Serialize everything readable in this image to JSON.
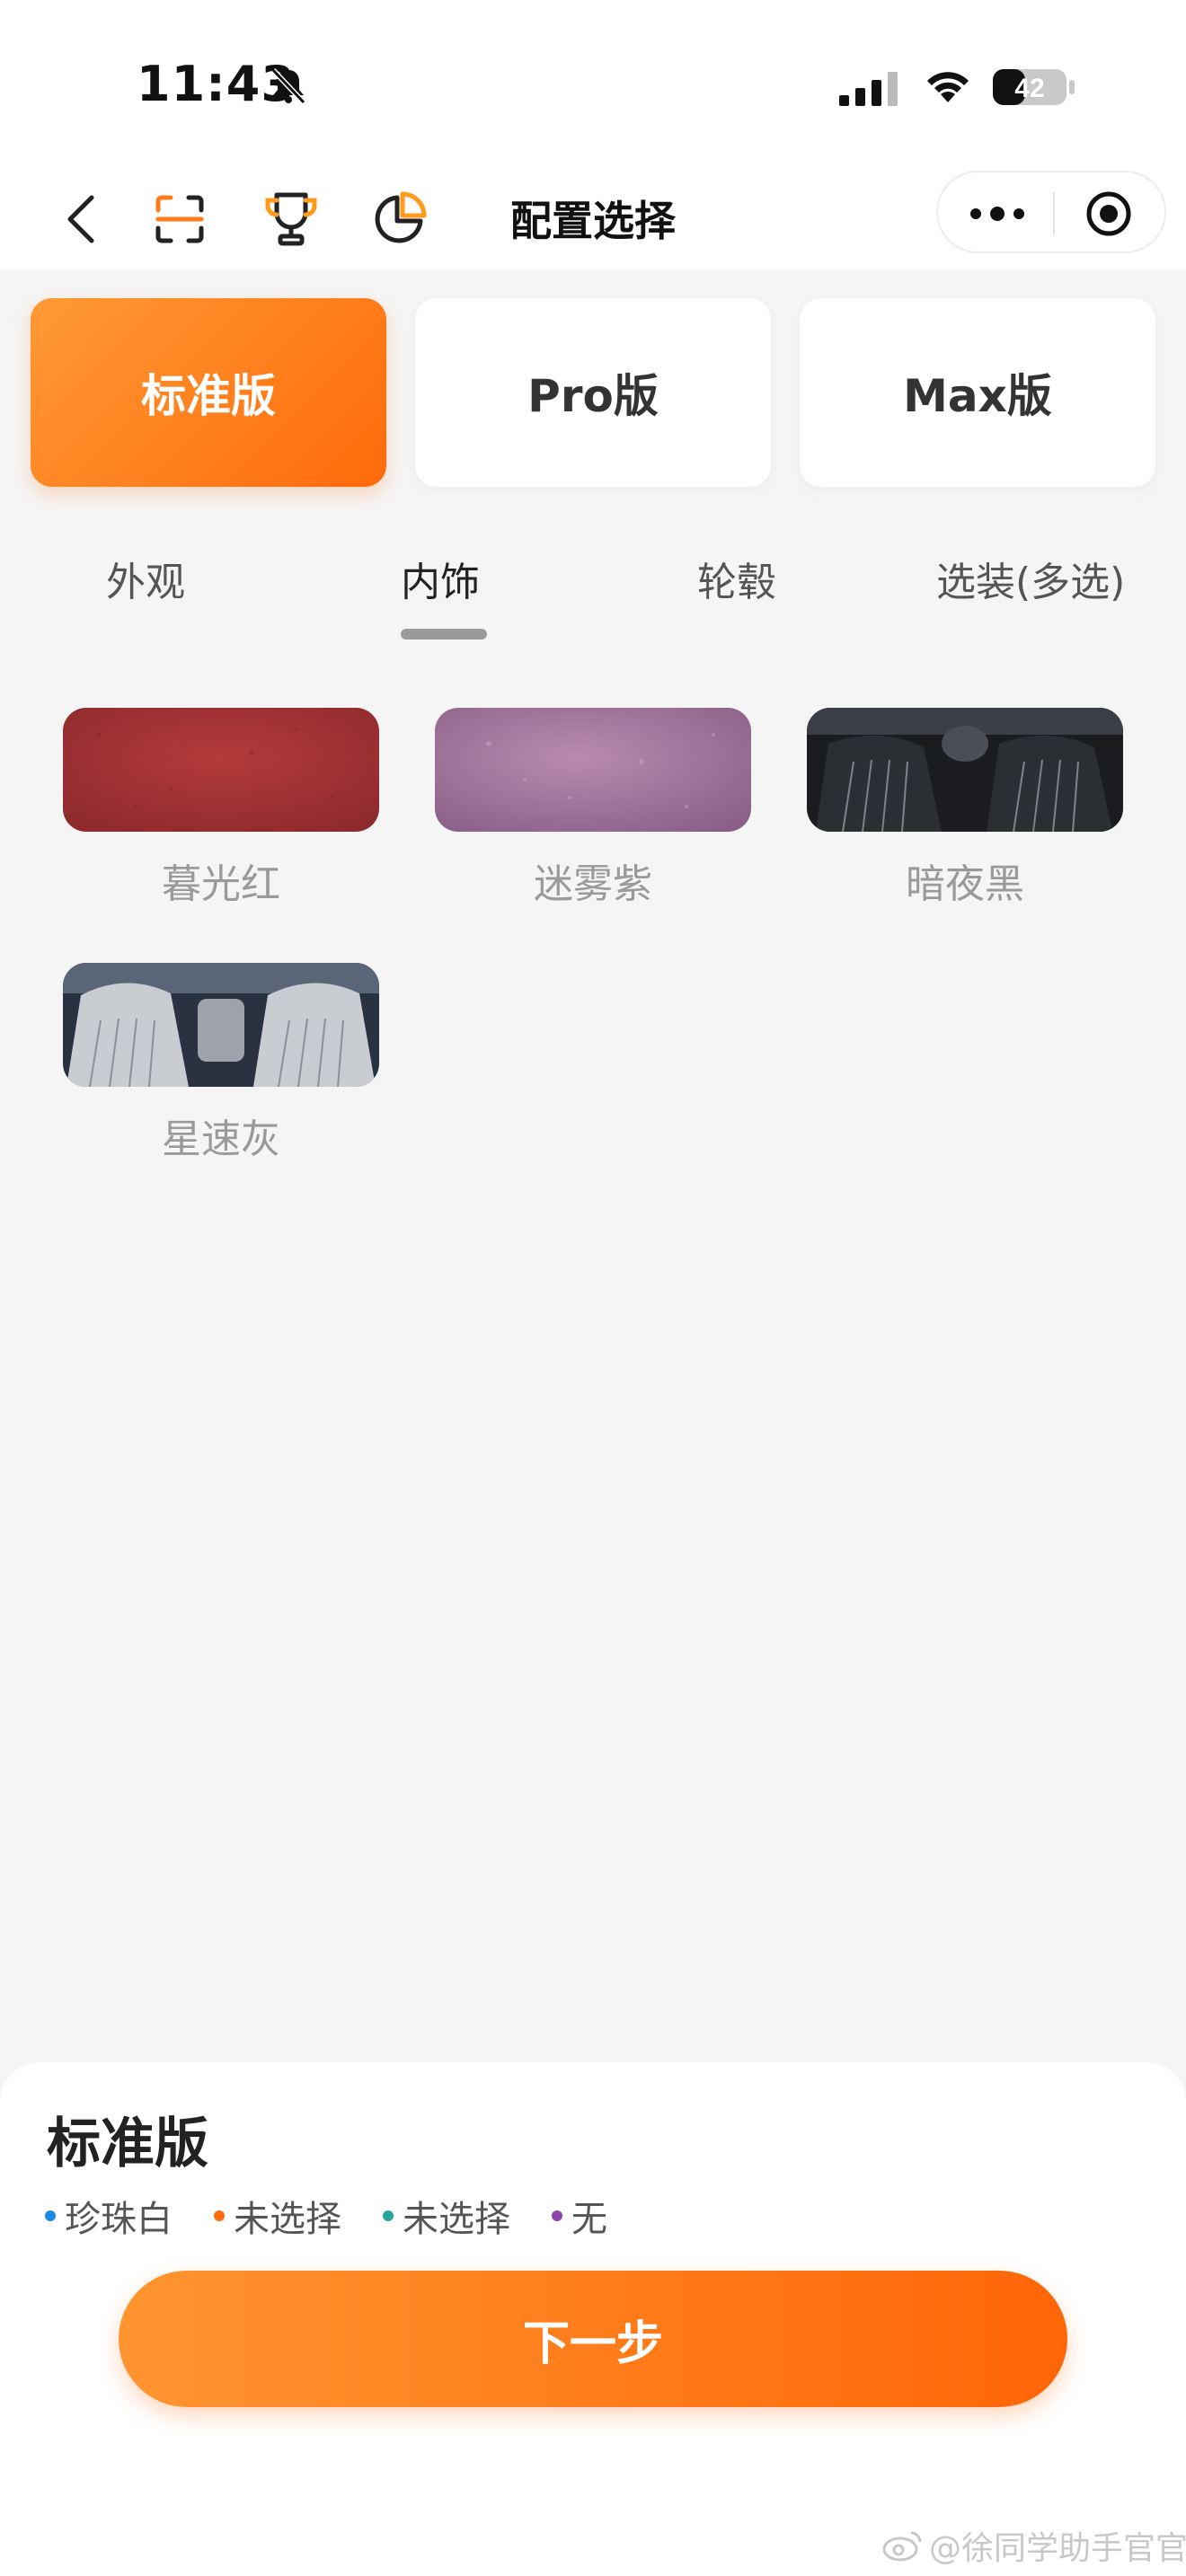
{
  "status_bar": {
    "time": "11:43",
    "battery": "42",
    "icons": [
      "bell-muted-icon",
      "signal-icon",
      "wifi-icon",
      "battery-icon"
    ]
  },
  "navbar": {
    "title": "配置选择",
    "icons": [
      "back-icon",
      "scan-icon",
      "trophy-icon",
      "pie-chart-icon",
      "more-icon",
      "target-icon"
    ]
  },
  "versions": [
    {
      "label": "标准版",
      "active": true
    },
    {
      "label": "Pro版",
      "active": false
    },
    {
      "label": "Max版",
      "active": false
    }
  ],
  "tabs": [
    {
      "label": "外观",
      "active": false
    },
    {
      "label": "内饰",
      "active": true
    },
    {
      "label": "轮毂",
      "active": false
    },
    {
      "label": "选装(多选)",
      "active": false
    }
  ],
  "swatches": [
    {
      "label": "暮光红"
    },
    {
      "label": "迷雾紫"
    },
    {
      "label": "暗夜黑"
    },
    {
      "label": "星速灰"
    }
  ],
  "summary": {
    "title": "标准版",
    "items": [
      {
        "label": "珍珠白",
        "color": "#1e88e5"
      },
      {
        "label": "未选择",
        "color": "#ff6a0a"
      },
      {
        "label": "未选择",
        "color": "#26a69a"
      },
      {
        "label": "无",
        "color": "#8e44ad"
      }
    ],
    "next_label": "下一步"
  },
  "watermark": "@徐同学助手官官",
  "colors": {
    "accent_start": "#ff9a35",
    "accent_end": "#ff6a0a",
    "background": "#f5f5f5"
  }
}
